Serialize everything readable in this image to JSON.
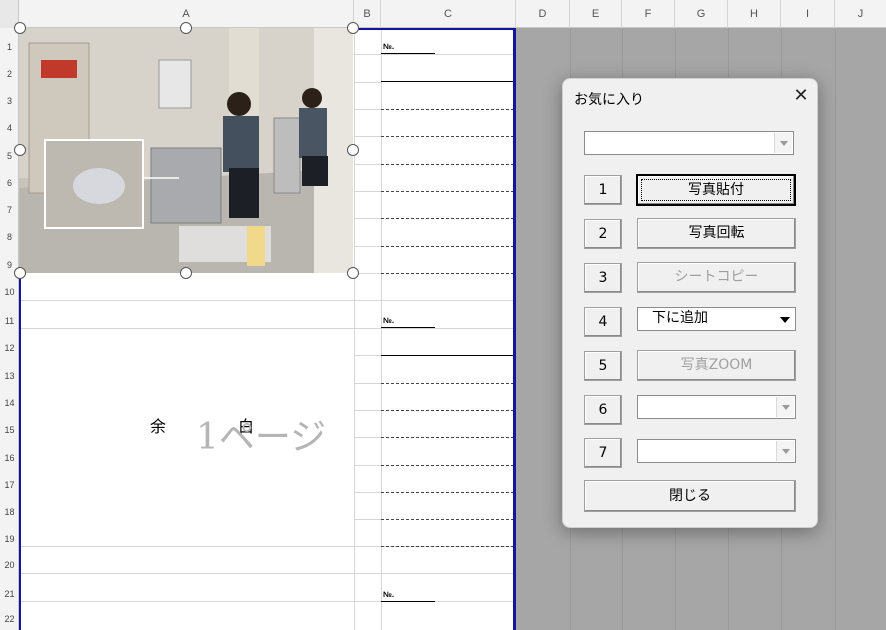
{
  "columns": [
    "A",
    "B",
    "C",
    "D",
    "E",
    "F",
    "G",
    "H",
    "I",
    "J"
  ],
  "rows": [
    "1",
    "2",
    "3",
    "4",
    "5",
    "6",
    "7",
    "8",
    "9",
    "10",
    "11",
    "12",
    "13",
    "14",
    "15",
    "16",
    "17",
    "18",
    "19",
    "20",
    "21",
    "22"
  ],
  "sheet": {
    "no_label": "№.",
    "margin_text": "余　白",
    "page_watermark": "1ページ"
  },
  "dialog": {
    "title": "お気に入り",
    "close_symbol": "✕",
    "top_combo_value": "",
    "rows": [
      {
        "num": "1",
        "label": "写真貼付",
        "kind": "button",
        "state": "focus"
      },
      {
        "num": "2",
        "label": "写真回転",
        "kind": "button",
        "state": "normal"
      },
      {
        "num": "3",
        "label": "シートコピー",
        "kind": "button",
        "state": "disabled"
      },
      {
        "num": "4",
        "label": "下に追加",
        "kind": "combo",
        "state": "active"
      },
      {
        "num": "5",
        "label": "写真ZOOM",
        "kind": "button",
        "state": "disabled"
      },
      {
        "num": "6",
        "label": "",
        "kind": "combo",
        "state": "disabled"
      },
      {
        "num": "7",
        "label": "",
        "kind": "combo",
        "state": "disabled"
      }
    ],
    "close_button_label": "閉じる"
  },
  "colors": {
    "page_border": "#1414a0",
    "outside_print_area": "#a6a6a6",
    "dialog_bg": "#f0f0f0"
  }
}
